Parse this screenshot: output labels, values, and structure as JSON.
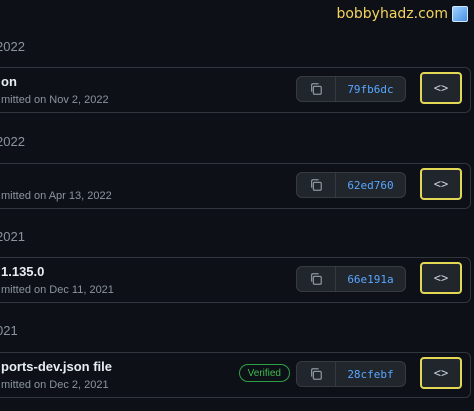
{
  "watermark": {
    "text": "bobbyhadz.com",
    "icon": "ice-cube-icon"
  },
  "groups": [
    {
      "heading": "2022",
      "commit": {
        "title": "on",
        "meta": "mitted on Nov 2, 2022",
        "sha": "79fb6dc",
        "browse_label": "<>",
        "verified": null
      }
    },
    {
      "heading": "2022",
      "commit": {
        "title": "",
        "meta": "mitted on Apr 13, 2022",
        "sha": "62ed760",
        "browse_label": "<>",
        "verified": null
      }
    },
    {
      "heading": "2021",
      "commit": {
        "title": "1.135.0",
        "meta": "mitted on Dec 11, 2021",
        "sha": "66e191a",
        "browse_label": "<>",
        "verified": null
      }
    },
    {
      "heading": "021",
      "commit": {
        "title": "ports-dev.json file",
        "meta": "mitted on Dec 2, 2021",
        "sha": "28cfebf",
        "browse_label": "<>",
        "verified": "Verified"
      }
    }
  ],
  "colors": {
    "background": "#0d1117",
    "sha_link": "#58a6ff",
    "highlight": "#e3d756",
    "verified": "#3fb950"
  }
}
